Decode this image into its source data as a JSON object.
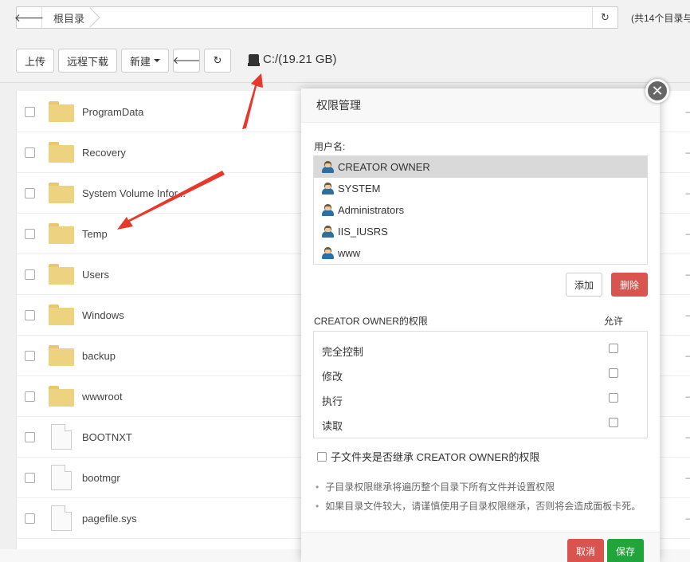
{
  "address": {
    "crumb": "根目录",
    "count_text": "(共14个目录与"
  },
  "toolbar": {
    "upload": "上传",
    "remote_download": "远程下载",
    "new": "新建",
    "disk_label": "C:/(19.21 GB)"
  },
  "files": [
    {
      "name": "ProgramData",
      "type": "folder"
    },
    {
      "name": "Recovery",
      "type": "folder"
    },
    {
      "name": "System Volume Infor...",
      "type": "folder"
    },
    {
      "name": "Temp",
      "type": "folder"
    },
    {
      "name": "Users",
      "type": "folder"
    },
    {
      "name": "Windows",
      "type": "folder"
    },
    {
      "name": "backup",
      "type": "folder"
    },
    {
      "name": "wwwroot",
      "type": "folder"
    },
    {
      "name": "BOOTNXT",
      "type": "file"
    },
    {
      "name": "bootmgr",
      "type": "file"
    },
    {
      "name": "pagefile.sys",
      "type": "file"
    }
  ],
  "dialog": {
    "title": "权限管理",
    "close_glyph": "✕",
    "username_label": "用户名:",
    "users": [
      "CREATOR OWNER",
      "SYSTEM",
      "Administrators",
      "IIS_IUSRS",
      "www"
    ],
    "selected_user": "CREATOR OWNER",
    "add": "添加",
    "delete": "删除",
    "perm_title": "CREATOR OWNER的权限",
    "allow": "允许",
    "perms": [
      "完全控制",
      "修改",
      "执行",
      "读取"
    ],
    "inherit": "子文件夹是否继承 CREATOR OWNER的权限",
    "notes": [
      "子目录权限继承将遍历整个目录下所有文件并设置权限",
      "如果目录文件较大，请谨慎使用子目录权限继承，否则将会造成面板卡死。"
    ],
    "cancel": "取消",
    "save": "保存"
  },
  "colors": {
    "danger": "#d9534f",
    "success": "#20a53a",
    "arrow": "#e8372b",
    "folder": "#edd27f"
  }
}
